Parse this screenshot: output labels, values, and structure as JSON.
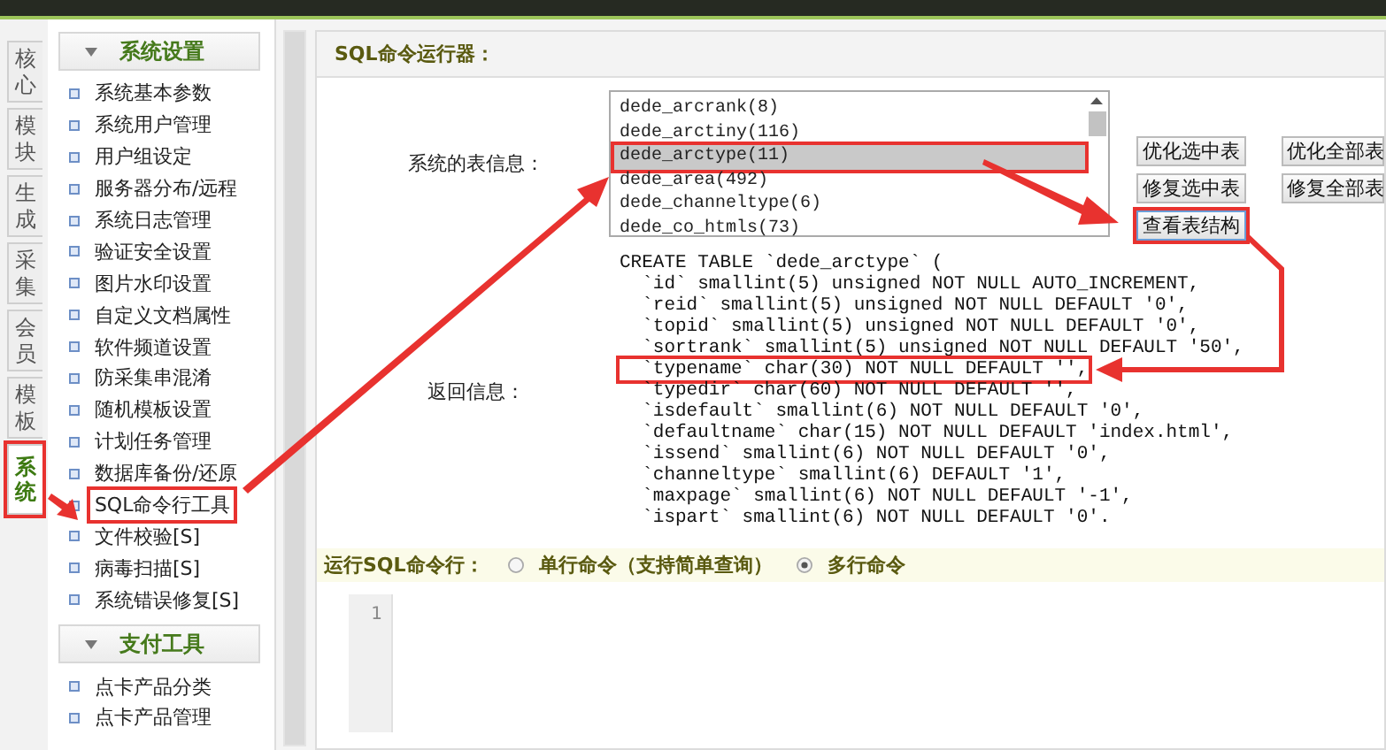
{
  "left_tabs": [
    {
      "label": "核心",
      "selected": false,
      "highlighted": false
    },
    {
      "label": "模块",
      "selected": false,
      "highlighted": false
    },
    {
      "label": "生成",
      "selected": false,
      "highlighted": false
    },
    {
      "label": "采集",
      "selected": false,
      "highlighted": false
    },
    {
      "label": "会员",
      "selected": false,
      "highlighted": false
    },
    {
      "label": "模板",
      "selected": false,
      "highlighted": false
    },
    {
      "label": "系统",
      "selected": true,
      "highlighted": true
    }
  ],
  "sidebar": {
    "groups": [
      {
        "title": "系统设置",
        "items": [
          {
            "label": "系统基本参数",
            "highlighted": false
          },
          {
            "label": "系统用户管理",
            "highlighted": false
          },
          {
            "label": "用户组设定",
            "highlighted": false
          },
          {
            "label": "服务器分布/远程",
            "highlighted": false
          },
          {
            "label": "系统日志管理",
            "highlighted": false
          },
          {
            "label": "验证安全设置",
            "highlighted": false
          },
          {
            "label": "图片水印设置",
            "highlighted": false
          },
          {
            "label": "自定义文档属性",
            "highlighted": false
          },
          {
            "label": "软件频道设置",
            "highlighted": false
          },
          {
            "label": "防采集串混淆",
            "highlighted": false
          },
          {
            "label": "随机模板设置",
            "highlighted": false
          },
          {
            "label": "计划任务管理",
            "highlighted": false
          },
          {
            "label": "数据库备份/还原",
            "highlighted": false
          },
          {
            "label": "SQL命令行工具",
            "highlighted": true
          },
          {
            "label": "文件校验[S]",
            "highlighted": false
          },
          {
            "label": "病毒扫描[S]",
            "highlighted": false
          },
          {
            "label": "系统错误修复[S]",
            "highlighted": false
          }
        ]
      },
      {
        "title": "支付工具",
        "items": [
          {
            "label": "点卡产品分类",
            "highlighted": false
          },
          {
            "label": "点卡产品管理",
            "highlighted": false
          }
        ]
      }
    ]
  },
  "panel": {
    "title": "SQL命令运行器：",
    "table_info": {
      "label": "系统的表信息：",
      "tables": [
        {
          "name": "dede_arcrank(8)",
          "selected": false,
          "highlighted": false
        },
        {
          "name": "dede_arctiny(116)",
          "selected": false,
          "highlighted": false
        },
        {
          "name": "dede_arctype(11)",
          "selected": true,
          "highlighted": true
        },
        {
          "name": "dede_area(492)",
          "selected": false,
          "highlighted": false
        },
        {
          "name": "dede_channeltype(6)",
          "selected": false,
          "highlighted": false
        },
        {
          "name": "dede_co_htmls(73)",
          "selected": false,
          "highlighted": false
        }
      ],
      "buttons": [
        {
          "label": "优化选中表",
          "highlighted": false
        },
        {
          "label": "优化全部表",
          "highlighted": false
        },
        {
          "label": "修复选中表",
          "highlighted": false
        },
        {
          "label": "修复全部表",
          "highlighted": false
        },
        {
          "label": "查看表结构",
          "highlighted": true
        }
      ]
    },
    "result": {
      "label": "返回信息：",
      "lines": [
        {
          "text": "CREATE TABLE `dede_arctype` (",
          "highlighted": false
        },
        {
          "text": "  `id` smallint(5) unsigned NOT NULL AUTO_INCREMENT,",
          "highlighted": false
        },
        {
          "text": "  `reid` smallint(5) unsigned NOT NULL DEFAULT '0',",
          "highlighted": false
        },
        {
          "text": "  `topid` smallint(5) unsigned NOT NULL DEFAULT '0',",
          "highlighted": false
        },
        {
          "text": "  `sortrank` smallint(5) unsigned NOT NULL DEFAULT '50',",
          "highlighted": false
        },
        {
          "text": "  `typename` char(30) NOT NULL DEFAULT '',",
          "highlighted": true
        },
        {
          "text": "  `typedir` char(60) NOT NULL DEFAULT '',",
          "highlighted": false
        },
        {
          "text": "  `isdefault` smallint(6) NOT NULL DEFAULT '0',",
          "highlighted": false
        },
        {
          "text": "  `defaultname` char(15) NOT NULL DEFAULT 'index.html',",
          "highlighted": false
        },
        {
          "text": "  `issend` smallint(6) NOT NULL DEFAULT '0',",
          "highlighted": false
        },
        {
          "text": "  `channeltype` smallint(6) DEFAULT '1',",
          "highlighted": false
        },
        {
          "text": "  `maxpage` smallint(6) NOT NULL DEFAULT '-1',",
          "highlighted": false
        },
        {
          "text": "  `ispart` smallint(6) NOT NULL DEFAULT '0'.",
          "highlighted": false
        }
      ]
    },
    "run": {
      "label": "运行SQL命令行：",
      "modes": [
        {
          "label": "单行命令（支持简单查询）",
          "selected": false
        },
        {
          "label": "多行命令",
          "selected": true
        }
      ]
    },
    "editor": {
      "line_numbers": [
        "1"
      ]
    }
  }
}
